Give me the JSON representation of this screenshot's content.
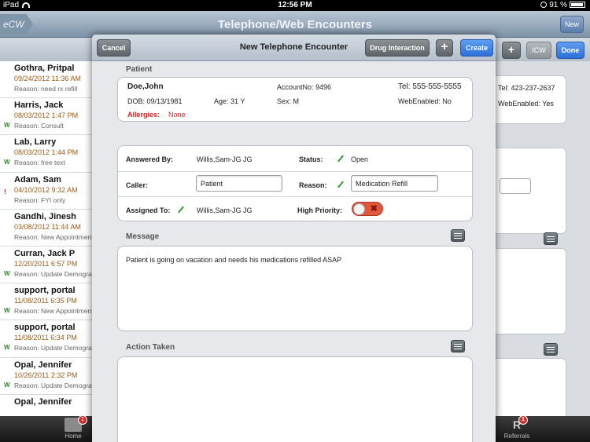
{
  "status_bar": {
    "device": "iPad",
    "time": "12:56 PM",
    "battery": "91 %"
  },
  "app": {
    "logo": "eCW",
    "title": "Telephone/Web Encounters",
    "new_label": "New"
  },
  "toolbar": {
    "icw_label": "ICW",
    "done_label": "Done"
  },
  "encounters": [
    {
      "name": "Gothra, Pritpal",
      "date": "09/24/2012 11:36 AM",
      "reason": "Reason: need rx refill",
      "marker": ""
    },
    {
      "name": "Harris, Jack",
      "date": "08/03/2012 1:47 PM",
      "reason": "Reason: Consult",
      "marker": "W"
    },
    {
      "name": "Lab, Larry",
      "date": "08/03/2012 1:44 PM",
      "reason": "Reason: free text",
      "marker": "W"
    },
    {
      "name": "Adam, Sam",
      "date": "04/10/2012 9:32 AM",
      "reason": "Reason: FYI only",
      "marker": "!"
    },
    {
      "name": "Gandhi, Jinesh",
      "date": "03/08/2012 11:44 AM",
      "reason": "Reason: New Appointment",
      "marker": ""
    },
    {
      "name": "Curran, Jack P",
      "date": "12/20/2011 6:57 PM",
      "reason": "Reason: Update Demographics",
      "marker": "W"
    },
    {
      "name": "support, portal",
      "date": "11/08/2011 6:35 PM",
      "reason": "Reason: New Appointment",
      "marker": "W"
    },
    {
      "name": "support, portal",
      "date": "11/08/2011 6:34 PM",
      "reason": "Reason: Update Demographics",
      "marker": "W"
    },
    {
      "name": "Opal, Jennifer",
      "date": "10/26/2011 2:32 PM",
      "reason": "Reason: Update Demographics",
      "marker": "W"
    },
    {
      "name": "Opal, Jennifer",
      "date": "",
      "reason": "",
      "marker": ""
    }
  ],
  "background_detail": {
    "tel": "Tel: 423-237-2637",
    "web_enabled": "WebEnabled: Yes"
  },
  "tabs": {
    "home": "Home",
    "referrals": "Referrals",
    "home_badge": "1",
    "referrals_badge": "1"
  },
  "modal": {
    "title": "New Telephone Encounter",
    "cancel_label": "Cancel",
    "drug_interaction_label": "Drug Interaction",
    "plus_label": "+",
    "create_label": "Create",
    "patient_section": "Patient",
    "patient": {
      "name": "Doe,John",
      "account": "AccountNo: 9496",
      "tel": "Tel:  555-555-5555",
      "dob": "DOB:  09/13/1981",
      "age": "Age:  31 Y",
      "sex": "Sex:  M",
      "web_enabled": "WebEnabled:  No",
      "allergies_label": "Allergies:",
      "allergies_value": "None"
    },
    "form": {
      "answered_by_label": "Answered By:",
      "answered_by_value": "Willis,Sam-JG JG",
      "status_label": "Status:",
      "status_value": "Open",
      "caller_label": "Caller:",
      "caller_value": "Patient",
      "reason_label": "Reason:",
      "reason_value": "Medication Refill",
      "assigned_to_label": "Assigned To:",
      "assigned_to_value": "Willis,Sam-JG JG",
      "high_priority_label": "High Priority:",
      "high_priority_on": false
    },
    "message_section": "Message",
    "message_text": "Patient is going on vacation and needs his medications refilled ASAP",
    "action_section": "Action Taken",
    "action_text": ""
  }
}
